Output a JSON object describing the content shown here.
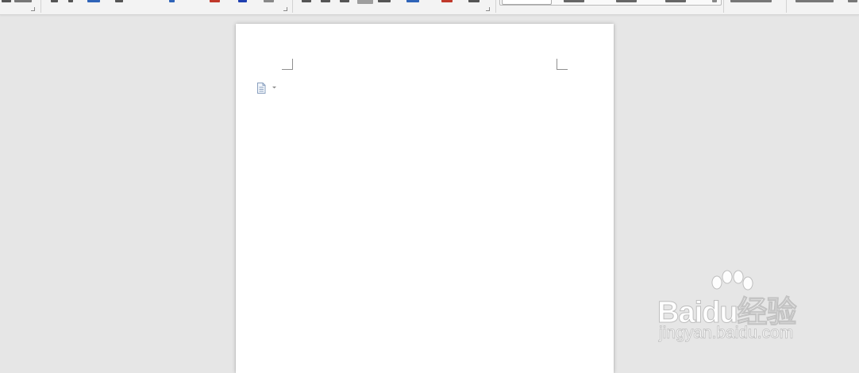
{
  "window": {
    "colors": {
      "workspace": "#e6e6e6",
      "ribbon": "#f3f3f3",
      "page": "#ffffff",
      "accent_blue": "#2f64b8",
      "accent_red": "#c0392b"
    }
  },
  "ribbon": {
    "icons": [
      "font-group-icon",
      "paragraph-group-icon",
      "styles-gallery-icon",
      "editing-group-icon"
    ]
  },
  "document": {
    "paste_options_icon": "paste-options-icon"
  },
  "watermark": {
    "brand": "Baidu经验",
    "url": "jingyan.baidu.com"
  }
}
